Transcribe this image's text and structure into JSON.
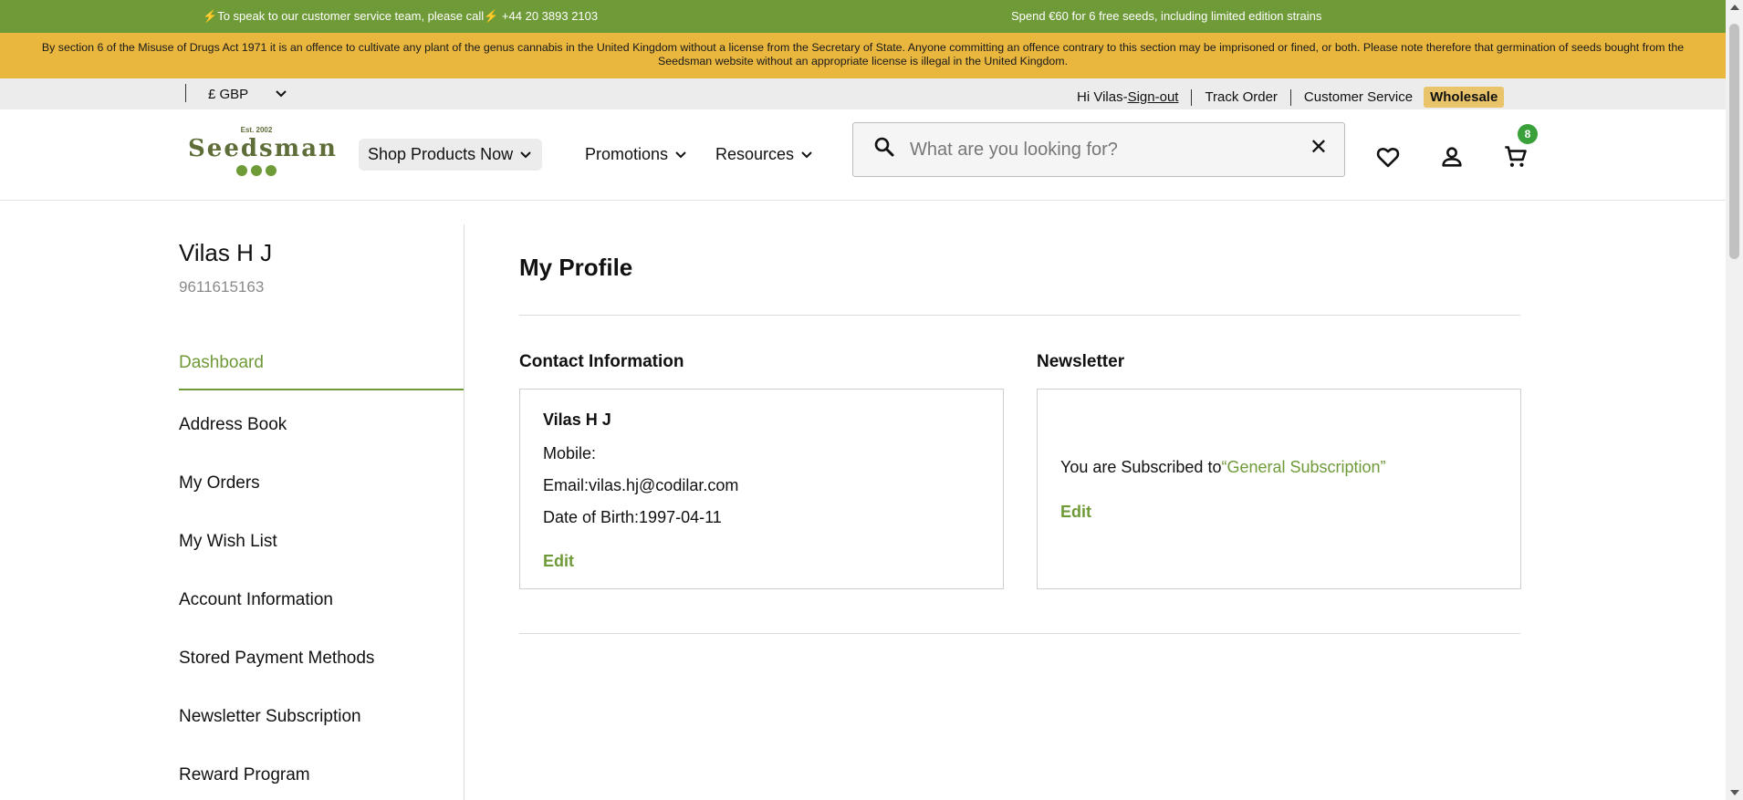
{
  "promo": {
    "phone_text": "To speak to our customer service team, please call",
    "phone_number": "+44 20 3893 2103",
    "offer": "Spend €60 for 6 free seeds, including limited edition strains"
  },
  "legal_notice": "By section 6 of the Misuse of Drugs Act 1971 it is an offence to cultivate any plant of the genus cannabis in the United Kingdom without a license from the Secretary of State. Anyone committing an offence contrary to this section may be imprisoned or fined, or both. Please note therefore that germination of seeds bought from the Seedsman website without an appropriate license is illegal in the United Kingdom.",
  "utility": {
    "currency": "£ GBP",
    "greeting": "Hi Vilas-",
    "sign_out": "Sign-out",
    "track_order": "Track Order",
    "customer_service": "Customer Service",
    "wholesale": "Wholesale"
  },
  "logo": {
    "est": "Est. 2002",
    "name": "Seedsman"
  },
  "nav": {
    "shop": "Shop Products Now",
    "promotions": "Promotions",
    "resources": "Resources"
  },
  "search": {
    "placeholder": "What are you looking for?",
    "clear_icon": "✕"
  },
  "cart": {
    "count": "8"
  },
  "customer": {
    "name": "Vilas H J",
    "phone": "9611615163"
  },
  "sidebar": {
    "items": [
      {
        "label": "Dashboard"
      },
      {
        "label": "Address Book"
      },
      {
        "label": "My Orders"
      },
      {
        "label": "My Wish List"
      },
      {
        "label": "Account Information"
      },
      {
        "label": "Stored Payment Methods"
      },
      {
        "label": "Newsletter Subscription"
      },
      {
        "label": "Reward Program"
      }
    ]
  },
  "main": {
    "title": "My Profile",
    "contact": {
      "heading": "Contact Information",
      "name": "Vilas H J",
      "mobile": "Mobile:",
      "email": "Email:vilas.hj@codilar.com",
      "dob": "Date of Birth:1997-04-11",
      "edit": "Edit"
    },
    "newsletter": {
      "heading": "Newsletter",
      "text": "You are Subscribed to",
      "subscription": "“General Subscription”",
      "edit": "Edit"
    }
  },
  "colors": {
    "brand_green": "#6f9a38",
    "notice_yellow": "#e9b63e",
    "badge_green": "#3aa13a"
  }
}
